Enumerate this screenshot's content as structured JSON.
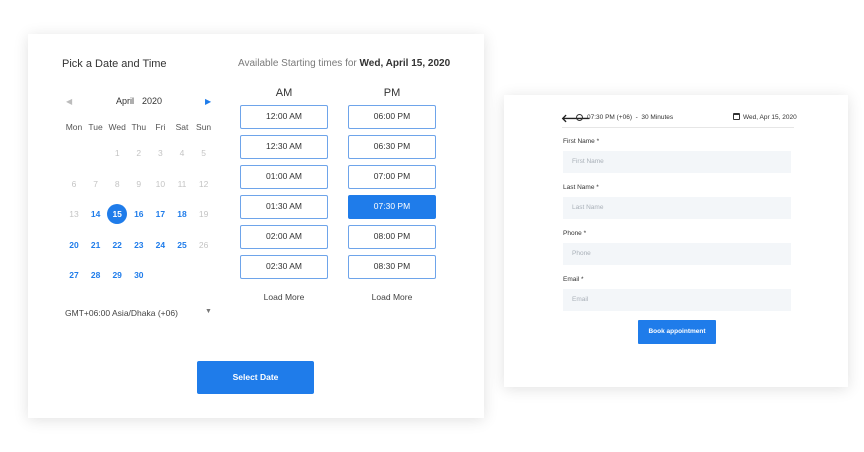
{
  "booking": {
    "title": "Pick a Date and Time",
    "available_prefix": "Available Starting times for",
    "available_date": "Wed, April 15, 2020",
    "nav_prev": "◀",
    "nav_next": "▶",
    "month": "April",
    "year": "2020",
    "weekdays": [
      "Mon",
      "Tue",
      "Wed",
      "Thu",
      "Fri",
      "Sat",
      "Sun"
    ],
    "weeks": [
      [
        {
          "d": "",
          "s": "e"
        },
        {
          "d": "",
          "s": "e"
        },
        {
          "d": "1",
          "s": "dis"
        },
        {
          "d": "2",
          "s": "dis"
        },
        {
          "d": "3",
          "s": "dis"
        },
        {
          "d": "4",
          "s": "dis"
        },
        {
          "d": "5",
          "s": "dis"
        }
      ],
      [
        {
          "d": "6",
          "s": "dis"
        },
        {
          "d": "7",
          "s": "dis"
        },
        {
          "d": "8",
          "s": "dis"
        },
        {
          "d": "9",
          "s": "dis"
        },
        {
          "d": "10",
          "s": "dis"
        },
        {
          "d": "11",
          "s": "dis"
        },
        {
          "d": "12",
          "s": "dis"
        }
      ],
      [
        {
          "d": "13",
          "s": "dis"
        },
        {
          "d": "14",
          "s": "av"
        },
        {
          "d": "15",
          "s": "sel"
        },
        {
          "d": "16",
          "s": "av"
        },
        {
          "d": "17",
          "s": "av"
        },
        {
          "d": "18",
          "s": "av"
        },
        {
          "d": "19",
          "s": "dis"
        }
      ],
      [
        {
          "d": "20",
          "s": "av"
        },
        {
          "d": "21",
          "s": "av"
        },
        {
          "d": "22",
          "s": "av"
        },
        {
          "d": "23",
          "s": "av"
        },
        {
          "d": "24",
          "s": "av"
        },
        {
          "d": "25",
          "s": "av"
        },
        {
          "d": "26",
          "s": "dis"
        }
      ],
      [
        {
          "d": "27",
          "s": "av"
        },
        {
          "d": "28",
          "s": "av"
        },
        {
          "d": "29",
          "s": "av"
        },
        {
          "d": "30",
          "s": "av"
        },
        {
          "d": "",
          "s": "e"
        },
        {
          "d": "",
          "s": "e"
        },
        {
          "d": "",
          "s": "e"
        }
      ]
    ],
    "timezone": "GMT+06:00 Asia/Dhaka (+06)",
    "timezone_caret": "▼",
    "am_label": "AM",
    "pm_label": "PM",
    "am_slots": [
      "12:00 AM",
      "12:30 AM",
      "01:00 AM",
      "01:30 AM",
      "02:00 AM",
      "02:30 AM"
    ],
    "pm_slots": [
      "06:00 PM",
      "06:30 PM",
      "07:00 PM",
      "07:30 PM",
      "08:00 PM",
      "08:30 PM"
    ],
    "selected_pm_slot": "07:30 PM",
    "load_more_am": "Load More",
    "load_more_pm": "Load More",
    "select_button": "Select Date"
  },
  "form": {
    "back_arrow": "🡐",
    "time_summary": "07:30 PM (+06)  -  30 Minutes",
    "date_summary": "Wed, Apr 15, 2020",
    "fields": [
      {
        "label": "First Name *",
        "placeholder": "First Name"
      },
      {
        "label": "Last Name *",
        "placeholder": "Last Name"
      },
      {
        "label": "Phone *",
        "placeholder": "Phone"
      },
      {
        "label": "Email *",
        "placeholder": "Email"
      }
    ],
    "submit_button": "Book appointment"
  },
  "colors": {
    "accent": "#1f7cea",
    "slot_border": "#6ea4ea",
    "disabled_day": "#c4c4c4",
    "input_bg": "#f3f6f9"
  }
}
